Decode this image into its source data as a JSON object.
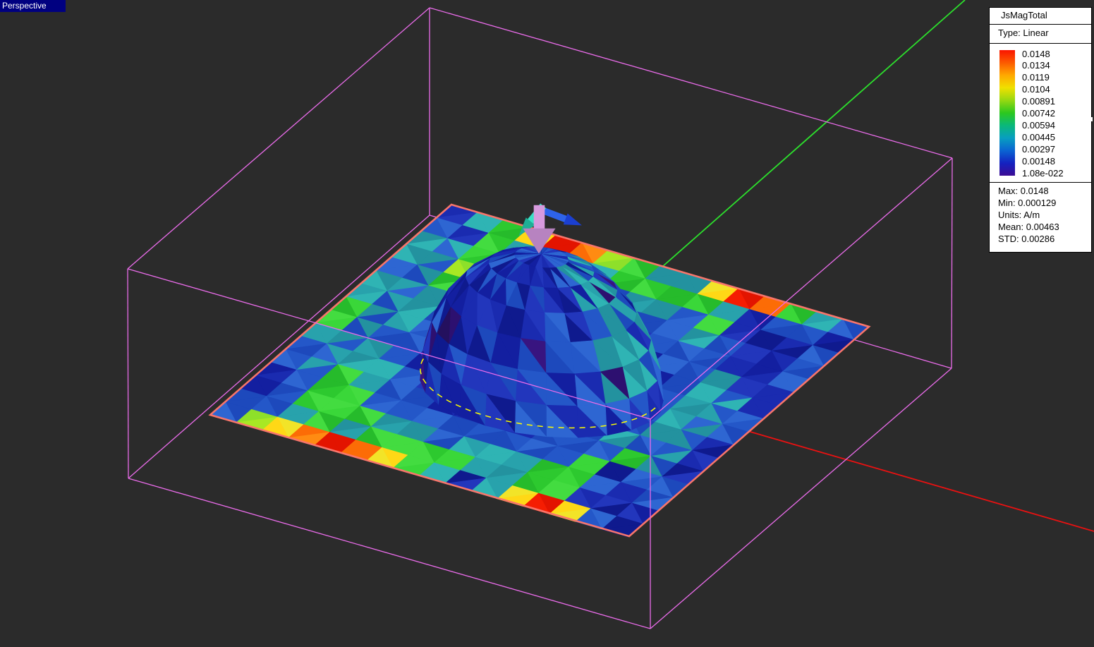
{
  "viewport": {
    "label": "Perspective"
  },
  "legend": {
    "title": "JsMagTotal",
    "type": "Type: Linear",
    "scale_values": [
      "0.0148",
      "0.0134",
      "0.0119",
      "0.0104",
      "0.00891",
      "0.00742",
      "0.00594",
      "0.00445",
      "0.00297",
      "0.00148",
      "1.08e-022"
    ],
    "stats": [
      "Max: 0.0148",
      "Min: 0.000129",
      "Units: A/m",
      "Mean: 0.00463",
      "STD: 0.00286"
    ]
  },
  "scene": {
    "colors": {
      "background": "#2b2b2b",
      "box_wire": "#ea6cea",
      "plate_border": "#f8756b",
      "axis_green": "#2ce02c",
      "axis_red": "#ea1111",
      "base_ring": "#ffff00",
      "label_bg": "#000080",
      "label_fg": "#ffffff",
      "arrow_pink": "#d79ade",
      "arrow_pink_dark": "#b783c0",
      "arrow_cyan": "#38dfc4",
      "arrow_cyan_dark": "#1fae96",
      "arrow_blue": "#2e63ea",
      "arrow_blue_dark": "#1b3fd0",
      "colorbar_stops": [
        "#fa1400",
        "#fc5a00",
        "#ffa800",
        "#f0e000",
        "#96d811",
        "#2cc81e",
        "#0ab87a",
        "#089ec0",
        "#0a64d2",
        "#1422c0",
        "#3c0c94"
      ]
    }
  }
}
